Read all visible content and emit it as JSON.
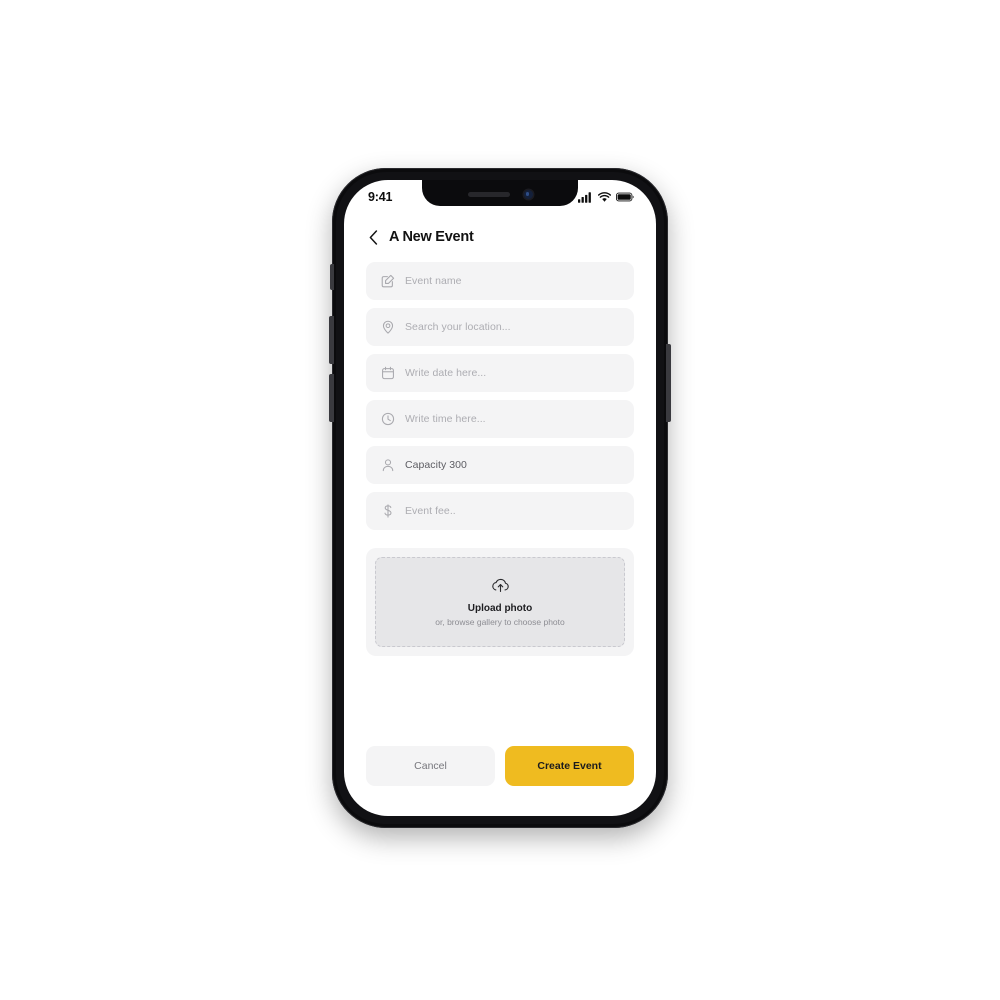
{
  "status_bar": {
    "time": "9:41",
    "icons": [
      "signal-icon",
      "wifi-icon",
      "battery-icon"
    ]
  },
  "header": {
    "back_icon": "chevron-left-icon",
    "title": "A New Event"
  },
  "form": {
    "fields": [
      {
        "name": "event-name",
        "icon": "edit-square-icon",
        "text": "Event name",
        "filled": false
      },
      {
        "name": "location",
        "icon": "map-pin-icon",
        "text": "Search your location...",
        "filled": false
      },
      {
        "name": "date",
        "icon": "calendar-icon",
        "text": "Write date here...",
        "filled": false
      },
      {
        "name": "time",
        "icon": "clock-icon",
        "text": "Write time here...",
        "filled": false
      },
      {
        "name": "capacity",
        "icon": "user-icon",
        "text": "Capacity 300",
        "filled": true
      },
      {
        "name": "fee",
        "icon": "dollar-icon",
        "text": "Event fee..",
        "filled": false
      }
    ]
  },
  "upload": {
    "icon": "cloud-upload-icon",
    "title": "Upload photo",
    "subtitle": "or, browse gallery to choose photo"
  },
  "actions": {
    "cancel_label": "Cancel",
    "create_label": "Create Event"
  },
  "colors": {
    "accent": "#efbb20",
    "field_bg": "#f4f4f5",
    "upload_bg": "#e6e6e8",
    "text_primary": "#121212",
    "text_placeholder": "#adadb2"
  }
}
